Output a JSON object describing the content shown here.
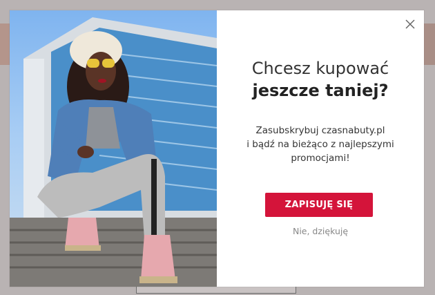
{
  "popup": {
    "heading_line1": "Chcesz kupować",
    "heading_line2": "jeszcze taniej?",
    "description_line1": "Zasubskrybuj czasnabuty.pl",
    "description_line2": "i bądź na bieżąco z najlepszymi",
    "description_line3": "promocjami!",
    "subscribe_label": "ZAPISUJĘ SIĘ",
    "decline_label": "Nie, dziękuję",
    "close_icon": "close-icon",
    "accent_color": "#d4143a"
  }
}
